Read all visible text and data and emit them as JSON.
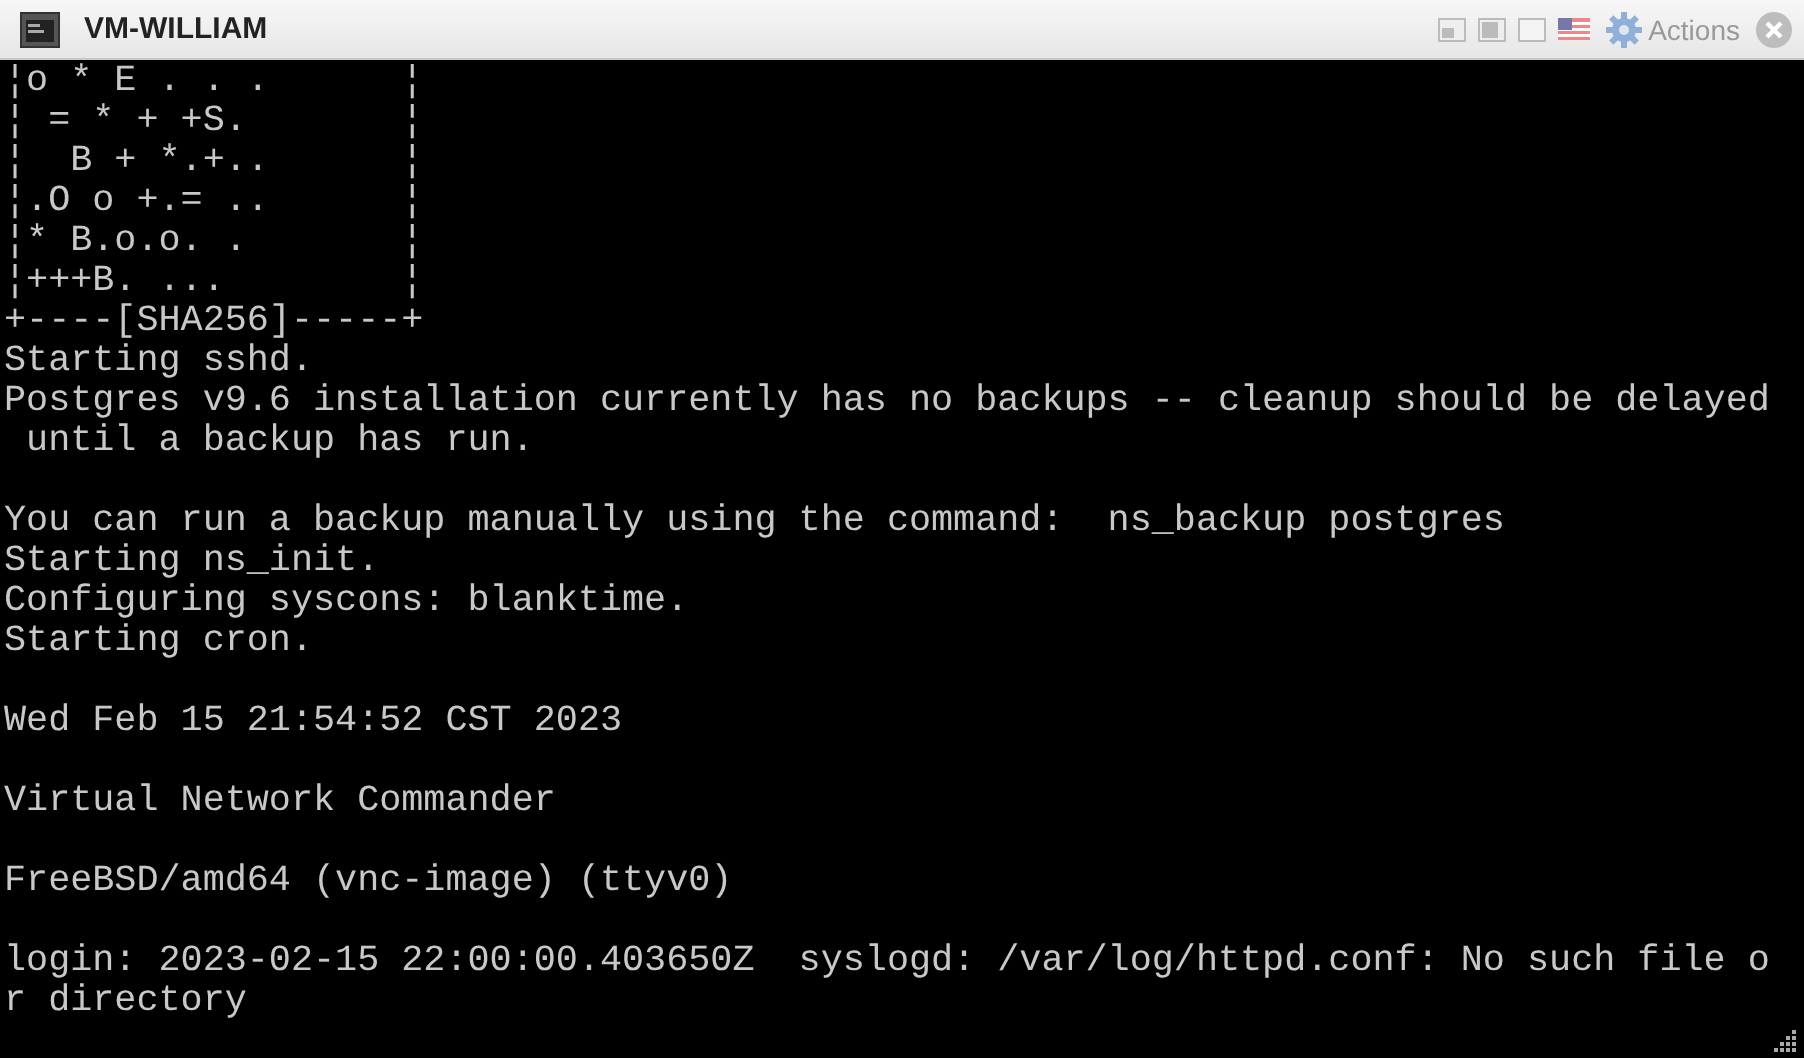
{
  "window": {
    "title": "VM-WILLIAM",
    "actions_label": "Actions"
  },
  "console": {
    "blocks": [
      [
        "¦o * E . . .      ¦",
        "¦ = * + +S.       ¦",
        "¦  B + *.+..      ¦",
        "¦.O o +.= ..      ¦",
        "¦* B.o.o. .       ¦",
        "¦+++B. ...        ¦",
        "+----[SHA256]-----+",
        "Starting sshd.",
        "Postgres v9.6 installation currently has no backups -- cleanup should be delayed",
        " until a backup has run."
      ],
      [
        "You can run a backup manually using the command:  ns_backup postgres",
        "Starting ns_init.",
        "Configuring syscons: blanktime.",
        "Starting cron."
      ],
      [
        "Wed Feb 15 21:54:52 CST 2023"
      ],
      [
        "Virtual Network Commander"
      ],
      [
        "FreeBSD/amd64 (vnc-image) (ttyv0)"
      ],
      [
        "login: 2023-02-15 22:00:00.403650Z  syslogd: /var/log/httpd.conf: No such file o",
        "r directory"
      ]
    ]
  }
}
